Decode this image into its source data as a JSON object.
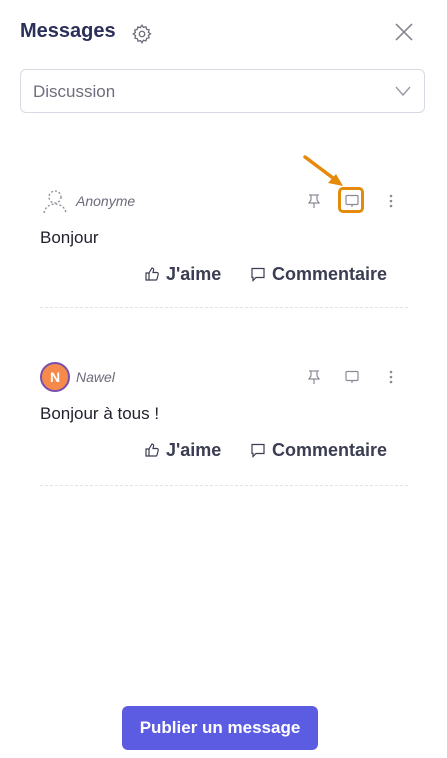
{
  "header": {
    "title": "Messages",
    "icons": [
      "gear-icon",
      "close-icon"
    ]
  },
  "filter": {
    "selected": "Discussion"
  },
  "posts": [
    {
      "author": "Anonyme",
      "avatar": "anonymous-user-icon",
      "text": "Bonjour",
      "like_label": "J'aime",
      "comment_label": "Commentaire",
      "present_highlighted": true
    },
    {
      "author": "Nawel",
      "avatar_initial": "N",
      "text": "Bonjour à tous !",
      "like_label": "J'aime",
      "comment_label": "Commentaire",
      "present_highlighted": false
    }
  ],
  "publish_button": "Publier un message",
  "colors": {
    "title": "#2b2f5a",
    "accent": "#5b5ce2",
    "highlight": "#e58a0a",
    "avatar_bg": "#f58a4b",
    "avatar_border": "#7a4fb0"
  }
}
